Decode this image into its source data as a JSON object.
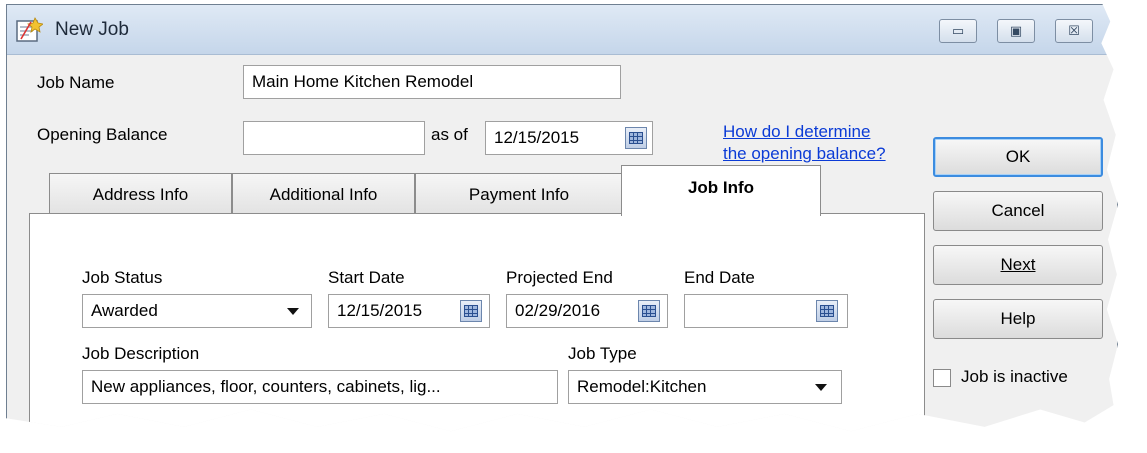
{
  "window": {
    "title": "New Job",
    "controls": {
      "minimize": "▭",
      "maximize": "▣",
      "close": "☒"
    }
  },
  "header": {
    "job_name_label": "Job Name",
    "job_name_value": "Main Home Kitchen Remodel",
    "opening_balance_label": "Opening Balance",
    "opening_balance_value": "",
    "as_of_label": "as of",
    "as_of_date": "12/15/2015",
    "help_link_line1": "How do I determine",
    "help_link_line2": "the opening balance?"
  },
  "tabs": [
    {
      "label": "Address Info",
      "active": false
    },
    {
      "label": "Additional Info",
      "active": false
    },
    {
      "label": "Payment Info",
      "active": false
    },
    {
      "label": "Job Info",
      "active": true
    }
  ],
  "job_info": {
    "job_status_label": "Job Status",
    "job_status_value": "Awarded",
    "start_date_label": "Start Date",
    "start_date_value": "12/15/2015",
    "projected_end_label": "Projected End",
    "projected_end_value": "02/29/2016",
    "end_date_label": "End Date",
    "end_date_value": "",
    "job_description_label": "Job Description",
    "job_description_value": "New appliances, floor, counters, cabinets, lig...",
    "job_type_label": "Job Type",
    "job_type_value": "Remodel:Kitchen"
  },
  "buttons": {
    "ok": "OK",
    "cancel": "Cancel",
    "next": "Next",
    "help": "Help"
  },
  "inactive_checkbox": {
    "label": "Job is inactive",
    "checked": false
  },
  "colors": {
    "link": "#0b3bd6",
    "default_button_border": "#3c8ce0",
    "titlebar": "#c5d6ea"
  }
}
